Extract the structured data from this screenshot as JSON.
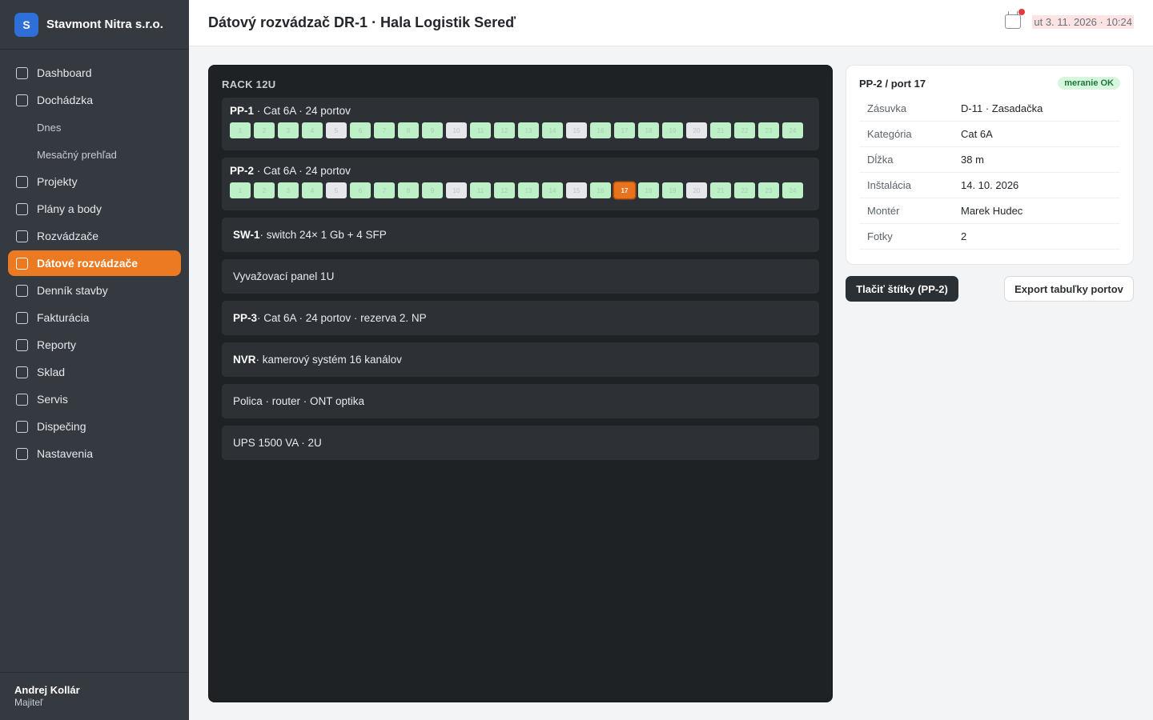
{
  "brand": {
    "logo_letter": "S",
    "name": "Stavmont Nitra s.r.o."
  },
  "nav": [
    {
      "label": "Dashboard",
      "type": "main"
    },
    {
      "label": "Dochádzka",
      "type": "main"
    },
    {
      "label": "Dnes",
      "type": "sub"
    },
    {
      "label": "Mesačný prehľad",
      "type": "sub"
    },
    {
      "label": "Projekty",
      "type": "main"
    },
    {
      "label": "Plány a body",
      "type": "main"
    },
    {
      "label": "Rozvádzače",
      "type": "main"
    },
    {
      "label": "Dátové rozvádzače",
      "type": "main",
      "active": true
    },
    {
      "label": "Denník stavby",
      "type": "main"
    },
    {
      "label": "Fakturácia",
      "type": "main"
    },
    {
      "label": "Reporty",
      "type": "main"
    },
    {
      "label": "Sklad",
      "type": "main"
    },
    {
      "label": "Servis",
      "type": "main"
    },
    {
      "label": "Dispečing",
      "type": "main"
    },
    {
      "label": "Nastavenia",
      "type": "main"
    }
  ],
  "user": {
    "name": "Andrej Kollár",
    "role": "Majiteľ"
  },
  "header": {
    "title": "Dátový rozvádzač DR-1 · Hala Logistik Sereď",
    "datetime": "ut 3. 11. 2026 · 10:24"
  },
  "rack": {
    "title": "RACK 12U",
    "patch_panels": [
      {
        "name": "PP-1",
        "desc": " · Cat 6A · 24 portov",
        "free_ports": [
          5,
          10,
          15,
          20
        ],
        "selected_port": null
      },
      {
        "name": "PP-2",
        "desc": " · Cat 6A · 24 portov",
        "free_ports": [
          5,
          10,
          15,
          20
        ],
        "selected_port": 17
      }
    ],
    "units": [
      {
        "name": "SW-1",
        "desc": " · switch 24× 1 Gb + 4 SFP"
      },
      {
        "name": "",
        "desc": "Vyvažovací panel 1U"
      },
      {
        "name": "PP-3",
        "desc": " · Cat 6A · 24 portov · rezerva 2. NP"
      },
      {
        "name": "NVR",
        "desc": " · kamerový systém 16 kanálov"
      },
      {
        "name": "",
        "desc": "Polica · router · ONT optika"
      },
      {
        "name": "",
        "desc": "UPS 1500 VA · 2U"
      }
    ]
  },
  "detail": {
    "title": "PP-2 / port 17",
    "badge": "meranie OK",
    "rows": [
      {
        "key": "Zásuvka",
        "value": "D-11 · Zasadačka"
      },
      {
        "key": "Kategória",
        "value": "Cat 6A"
      },
      {
        "key": "Dĺžka",
        "value": "38 m"
      },
      {
        "key": "Inštalácia",
        "value": "14. 10. 2026"
      },
      {
        "key": "Montér",
        "value": "Marek Hudec"
      },
      {
        "key": "Fotky",
        "value": "2"
      }
    ]
  },
  "actions": {
    "print_label": "Tlačiť štítky (PP-2)",
    "export_label": "Export tabuľky portov"
  },
  "colors": {
    "accent": "#ec7a22",
    "sidebar": "#353a40",
    "port_ok": "#bdf0c6",
    "port_free": "#e6e7ea"
  }
}
